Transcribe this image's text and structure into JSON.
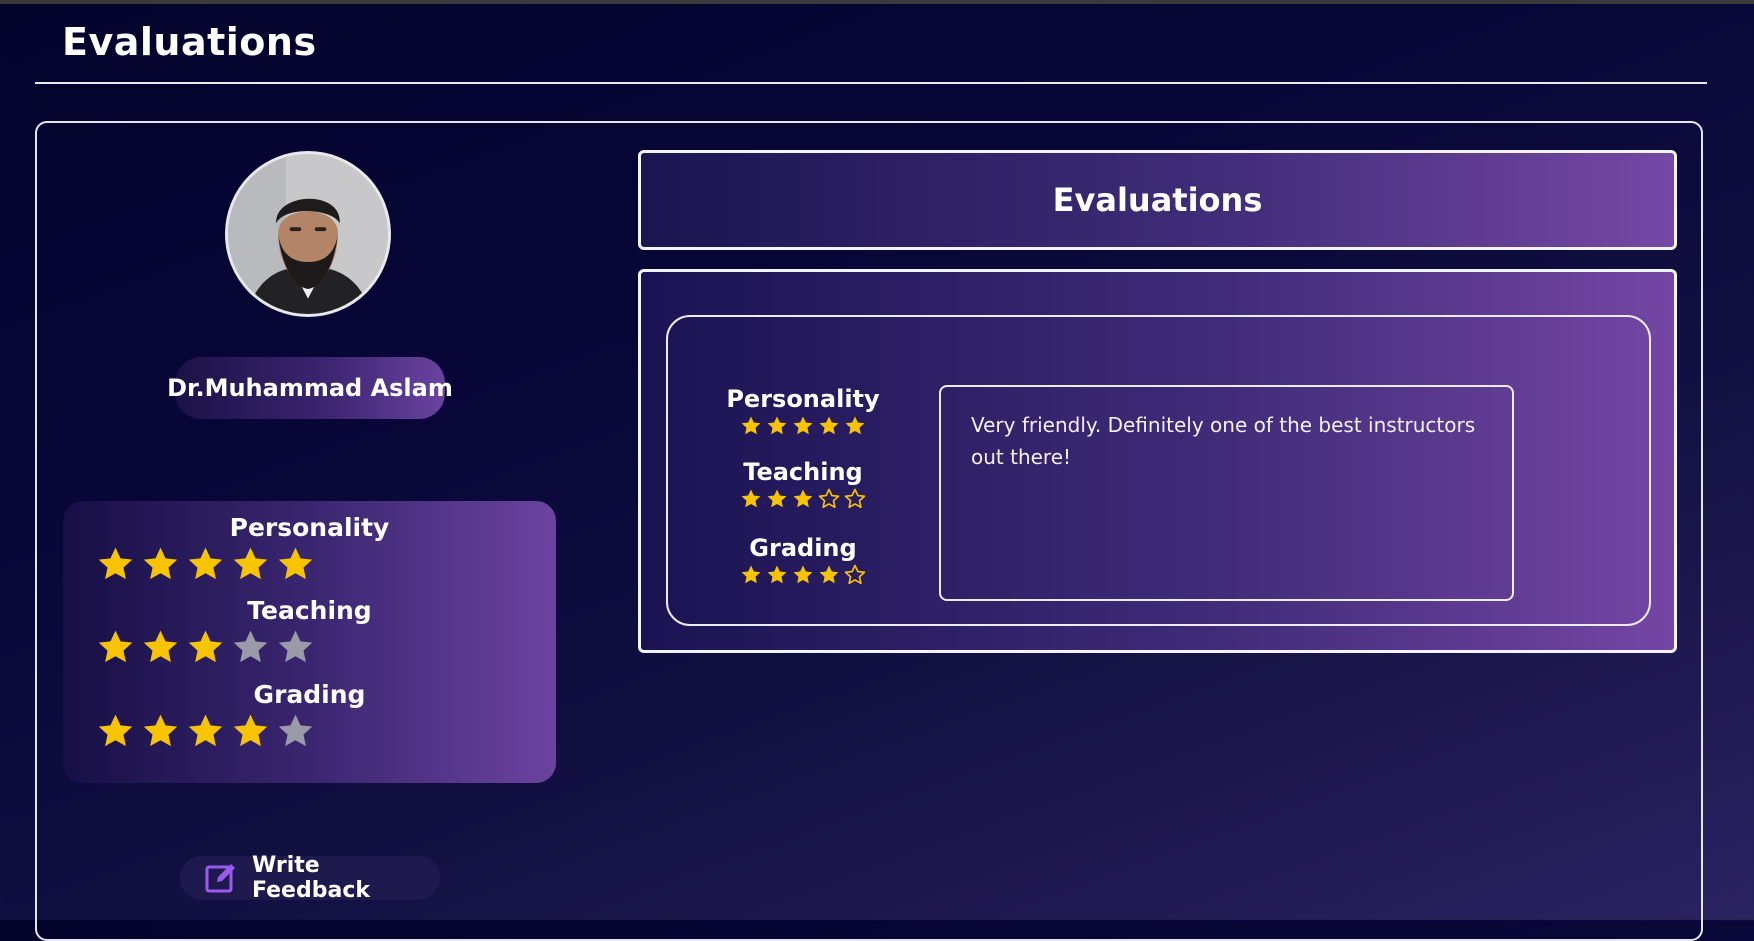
{
  "page": {
    "title": "Evaluations"
  },
  "profile": {
    "name": "Dr.Muhammad Aslam",
    "ratings": [
      {
        "label": "Personality",
        "stars": 5,
        "max": 5
      },
      {
        "label": "Teaching",
        "stars": 3,
        "max": 5
      },
      {
        "label": "Grading",
        "stars": 4,
        "max": 5
      }
    ],
    "write_feedback_label": "Write Feedback"
  },
  "evaluations": {
    "header": "Evaluations",
    "reviews": [
      {
        "ratings": [
          {
            "label": "Personality",
            "stars": 5,
            "max": 5
          },
          {
            "label": "Teaching",
            "stars": 3,
            "max": 5
          },
          {
            "label": "Grading",
            "stars": 4,
            "max": 5
          }
        ],
        "comment": "Very friendly. Definitely one of the best instructors out there!"
      }
    ]
  },
  "colors": {
    "star_filled": "#f8c400",
    "star_empty": "#9a9aa8",
    "accent": "#7a4aa8",
    "feedback_icon": "#9b59f0"
  },
  "icons": {
    "feedback": "edit-square-icon",
    "rating": "star-icon"
  }
}
